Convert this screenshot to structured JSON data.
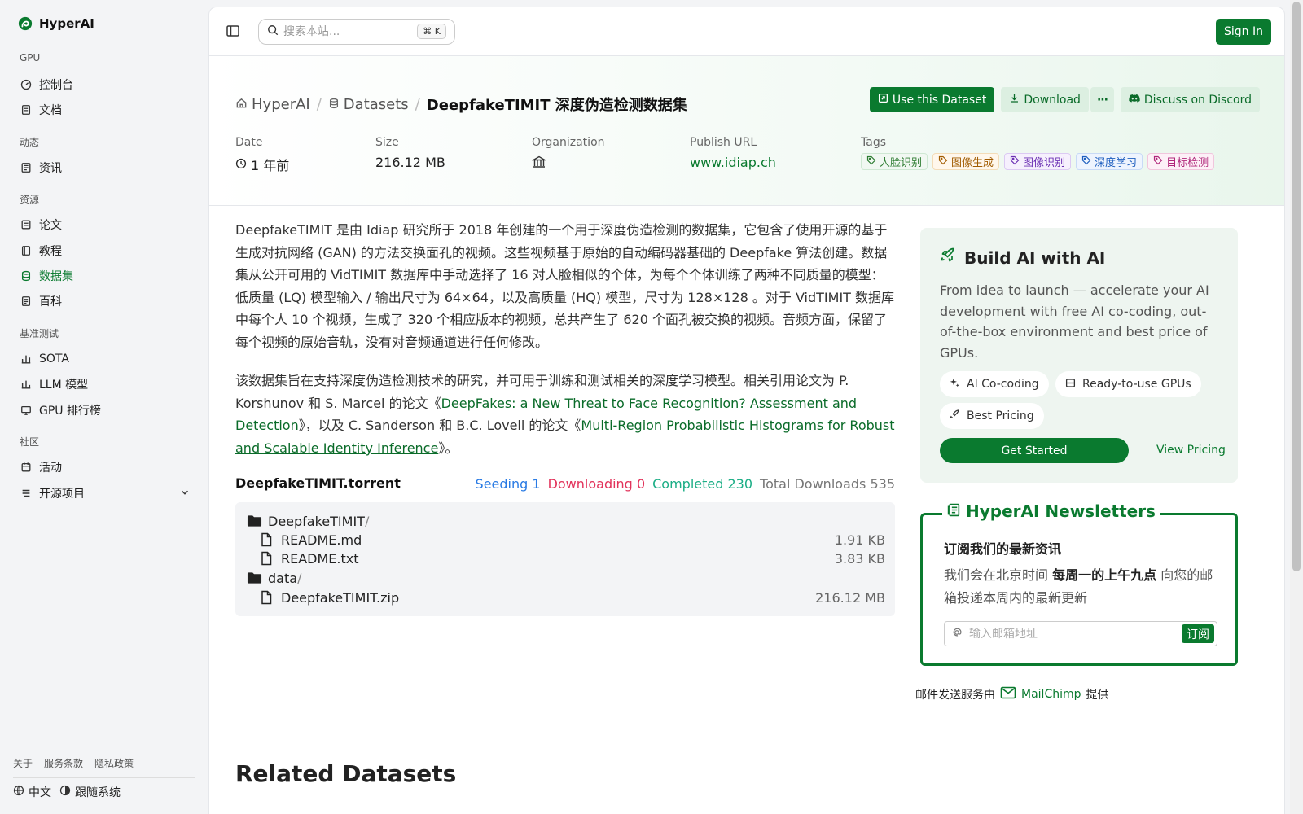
{
  "sidebar": {
    "logo_text": "HyperAI",
    "groups": {
      "gpu": "GPU",
      "dynamics": "动态",
      "resources": "资源",
      "benchmarks": "基准测试",
      "community": "社区"
    },
    "items": {
      "console": "控制台",
      "docs": "文档",
      "news": "资讯",
      "papers": "论文",
      "tutorials": "教程",
      "datasets": "数据集",
      "wiki": "百科",
      "sota": "SOTA",
      "llm": "LLM 模型",
      "gpu_rank": "GPU 排行榜",
      "events": "活动",
      "opensource": "开源项目"
    },
    "footer": {
      "about": "关于",
      "terms": "服务条款",
      "privacy": "隐私政策",
      "language": "中文",
      "theme": "跟随系统"
    }
  },
  "topbar": {
    "search_placeholder": "搜索本站...",
    "search_shortcut": "⌘ K",
    "signin": "Sign In"
  },
  "header": {
    "breadcrumb": {
      "home": "HyperAI",
      "datasets": "Datasets",
      "current": "DeepfakeTIMIT 深度伪造检测数据集"
    },
    "actions": {
      "use": "Use this Dataset",
      "download": "Download",
      "more": "···",
      "discord": "Discuss on Discord"
    },
    "meta": {
      "date_label": "Date",
      "date_value": "1 年前",
      "size_label": "Size",
      "size_value": "216.12 MB",
      "org_label": "Organization",
      "url_label": "Publish URL",
      "url_value": "www.idiap.ch",
      "tags_label": "Tags"
    },
    "tags": [
      {
        "label": "人脸识别",
        "color": "#2e7d32",
        "bg": "#f1f8f2",
        "border": "#cfe8d3"
      },
      {
        "label": "图像生成",
        "color": "#a15c00",
        "bg": "#fff7ec",
        "border": "#f3dcb8"
      },
      {
        "label": "图像识别",
        "color": "#6b2fb3",
        "bg": "#f6f0fd",
        "border": "#dccaf3"
      },
      {
        "label": "深度学习",
        "color": "#1f5fbf",
        "bg": "#eef4fe",
        "border": "#c8daf6"
      },
      {
        "label": "目标检测",
        "color": "#b0277a",
        "bg": "#fdf0f7",
        "border": "#f1c6dd"
      }
    ]
  },
  "description": {
    "p1": "DeepfakeTIMIT 是由 Idiap 研究所于 2018 年创建的一个用于深度伪造检测的数据集，它包含了使用开源的基于生成对抗网络 (GAN) 的方法交换面孔的视频。这些视频基于原始的自动编码器基础的 Deepfake 算法创建。数据集从公开可用的 VidTIMIT 数据库中手动选择了 16 对人脸相似的个体，为每个个体训练了两种不同质量的模型：低质量 (LQ) 模型输入 / 输出尺寸为 64×64，以及高质量 (HQ) 模型，尺寸为 128×128 。对于 VidTIMIT 数据库中每个人 10 个视频，生成了 320 个相应版本的视频，总共产生了 620 个面孔被交换的视频。音频方面，保留了每个视频的原始音轨，没有对音频通道进行任何修改。",
    "p2_a": "该数据集旨在支持深度伪造检测技术的研究，并可用于训练和测试相关的深度学习模型。相关引用论文为 P. Korshunov 和 S. Marcel 的论文《",
    "p2_link1": "DeepFakes: a New Threat to Face Recognition? Assessment and Detection",
    "p2_b": "》，以及 C. Sanderson 和 B.C. Lovell 的论文《",
    "p2_link2": "Multi-Region Probabilistic Histograms for Robust and Scalable Identity Inference",
    "p2_c": "》。"
  },
  "torrent": {
    "title": "DeepfakeTIMIT.torrent",
    "seeding_label": "Seeding",
    "seeding": "1",
    "downloading_label": "Downloading",
    "downloading": "0",
    "completed_label": "Completed",
    "completed": "230",
    "total_label": "Total Downloads",
    "total": "535",
    "files": {
      "folder1": "DeepfakeTIMIT",
      "readme_md": "README.md",
      "readme_md_size": "1.91 KB",
      "readme_txt": "README.txt",
      "readme_txt_size": "3.83 KB",
      "folder2": "data",
      "zip": "DeepfakeTIMIT.zip",
      "zip_size": "216.12 MB",
      "slash": "/"
    }
  },
  "related_title": "Related Datasets",
  "build": {
    "title": "Build AI with AI",
    "desc": "From idea to launch — accelerate your AI development with free AI co-coding, out-of-the-box environment and best price of GPUs.",
    "chip1": "AI Co-coding",
    "chip2": "Ready-to-use GPUs",
    "chip3": "Best Pricing",
    "get_started": "Get Started",
    "view_pricing": "View Pricing"
  },
  "newsletter": {
    "title": "HyperAI Newsletters",
    "subtitle": "订阅我们的最新资讯",
    "desc_a": "我们会在北京时间 ",
    "desc_bold": "每周一的上午九点",
    "desc_b": " 向您的邮箱投递本周内的最新更新",
    "email_placeholder": "输入邮箱地址",
    "subscribe": "订阅",
    "mail_prefix": "邮件发送服务由",
    "mailchimp": "MailChimp",
    "mail_suffix": "提供"
  }
}
